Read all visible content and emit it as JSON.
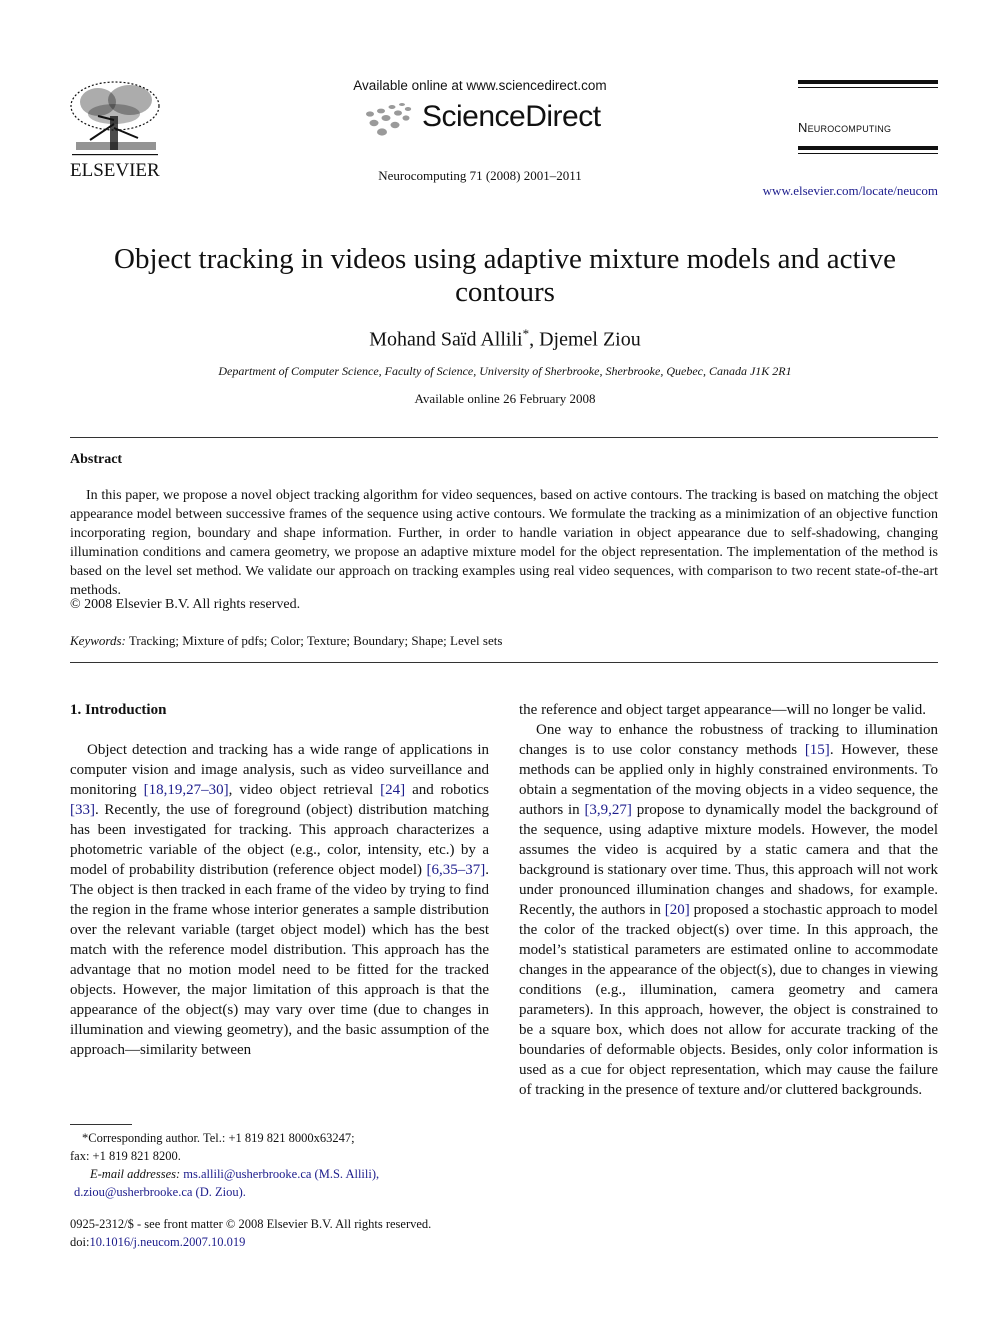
{
  "header": {
    "publisher_wordmark": "ELSEVIER",
    "available_online": "Available online at www.sciencedirect.com",
    "platform_name": "ScienceDirect",
    "journal_citation": "Neurocomputing 71 (2008) 2001–2011",
    "journal_name": "Neurocomputing",
    "journal_url": "www.elsevier.com/locate/neucom"
  },
  "article": {
    "title": "Object tracking in videos using adaptive mixture models and active contours",
    "authors": [
      {
        "name": "Mohand Saïd Allili",
        "mark": "*"
      },
      {
        "name": "Djemel Ziou",
        "mark": ""
      }
    ],
    "author_separator": ", ",
    "affiliation": "Department of Computer Science, Faculty of Science, University of Sherbrooke, Sherbrooke, Quebec, Canada J1K 2R1",
    "available_date": "Available online 26 February 2008"
  },
  "abstract": {
    "heading": "Abstract",
    "text": "In this paper, we propose a novel object tracking algorithm for video sequences, based on active contours. The tracking is based on matching the object appearance model between successive frames of the sequence using active contours. We formulate the tracking as a minimization of an objective function incorporating region, boundary and shape information. Further, in order to handle variation in object appearance due to self-shadowing, changing illumination conditions and camera geometry, we propose an adaptive mixture model for the object representation. The implementation of the method is based on the level set method. We validate our approach on tracking examples using real video sequences, with comparison to two recent state-of-the-art methods.",
    "copyright": "© 2008 Elsevier B.V. All rights reserved.",
    "keywords_label": "Keywords:",
    "keywords": "Tracking; Mixture of pdfs; Color; Texture; Boundary; Shape; Level sets"
  },
  "body": {
    "section_heading": "1.  Introduction",
    "left": {
      "p1_a": "Object detection and tracking has a wide range of applications in computer vision and image analysis, such as video surveillance and monitoring ",
      "ref1": "[18,19,27–30]",
      "p1_b": ", video object retrieval ",
      "ref2": "[24]",
      "p1_c": " and robotics ",
      "ref3": "[33]",
      "p1_d": ". Recently, the use of foreground (object) distribution matching has been investigated for tracking. This approach characterizes a photometric variable of the object (e.g., color, intensity, etc.) by a model of probability distribution (reference object model) ",
      "ref4": "[6,35–37]",
      "p1_e": ". The object is then tracked in each frame of the video by trying to find the region in the frame whose interior generates a sample distribution over the relevant variable (target object model) which has the best match with the reference model distribution. This approach has the advantage that no motion model need to be fitted for the tracked objects. However, the major limitation of this approach is that the appearance of the object(s) may vary over time (due to changes in illumination and viewing geometry), and the basic assumption of the approach—similarity between"
    },
    "right": {
      "cont": "the reference and object target appearance—will no longer be valid.",
      "p2_a": "One way to enhance the robustness of tracking to illumination changes is to use color constancy methods ",
      "ref5": "[15]",
      "p2_b": ". However, these methods can be applied only in highly constrained environments. To obtain a segmentation of the moving objects in a video sequence, the authors in ",
      "ref6": "[3,9,27]",
      "p2_c": " propose to dynamically model the background of the sequence, using adaptive mixture models. However, the model assumes the video is acquired by a static camera and that the background is stationary over time. Thus, this approach will not work under pronounced illumination changes and shadows, for example. Recently, the authors in ",
      "ref7": "[20]",
      "p2_d": " proposed a stochastic approach to model the color of the tracked object(s) over time. In this approach, the model’s statistical parameters are estimated online to accommodate changes in the appearance of the object(s), due to changes in viewing conditions (e.g., illumination, camera geometry and camera parameters). In this approach, however, the object is constrained to be a square box, which does not allow for accurate tracking of the boundaries of deformable objects. Besides, only color information is used as a cue for object representation, which may cause the failure of tracking in the presence of texture and/or cluttered backgrounds."
    }
  },
  "footnotes": {
    "corresponding": "*Corresponding author. Tel.:  +1 819 821 8000x63247;",
    "fax": "fax:  +1 819 821 8200.",
    "email_label": "E-mail addresses:",
    "email1": "ms.allili@usherbrooke.ca (M.S. Allili),",
    "email2": "d.ziou@usherbrooke.ca (D. Ziou)."
  },
  "front_matter": {
    "issn_line": "0925-2312/$ - see front matter © 2008 Elsevier B.V. All rights reserved.",
    "doi_label": "doi:",
    "doi": "10.1016/j.neucom.2007.10.019"
  },
  "icons": {
    "publisher_logo": "elsevier-tree-logo",
    "platform_logo": "sciencedirect-dots-logo"
  },
  "colors": {
    "link": "#1c1c8c",
    "text": "#111111",
    "sd_dots": "#9a9a9a"
  }
}
